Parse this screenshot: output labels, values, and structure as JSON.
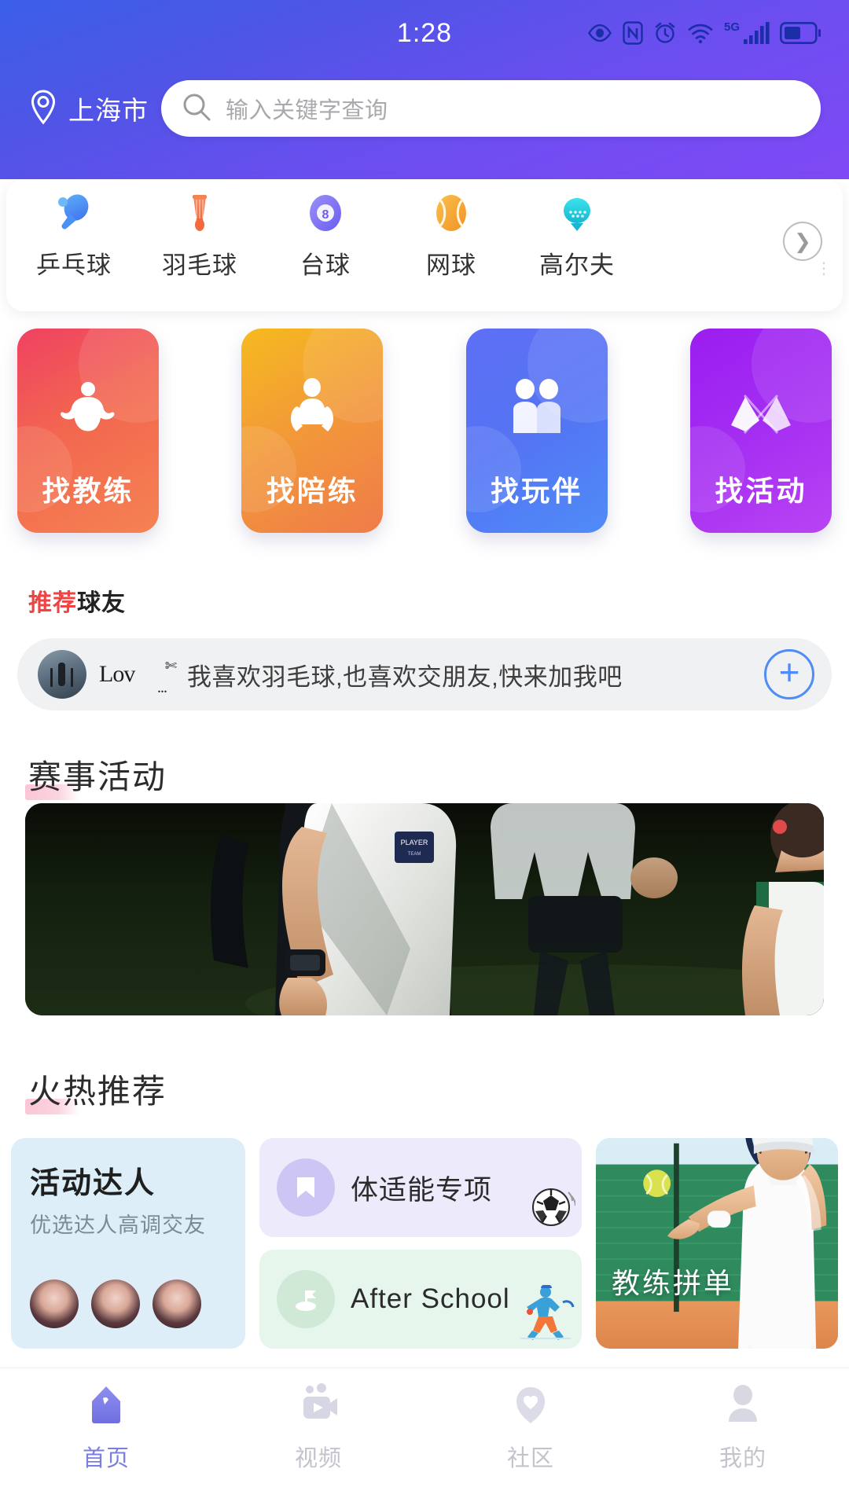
{
  "statusbar": {
    "time": "1:28",
    "network": "5G",
    "icons": [
      "eye-care-icon",
      "nfc-icon",
      "alarm-icon",
      "wifi-icon",
      "signal-icon",
      "battery-icon"
    ]
  },
  "header": {
    "location": "上海市",
    "location_icon": "location-pin-icon",
    "search_placeholder": "输入关键字查询",
    "search_icon": "search-icon",
    "gradient_from": "#3b5fe8",
    "gradient_to": "#8049f5"
  },
  "categories": {
    "more_icon": "chevron-right-icon",
    "items": [
      {
        "label": "乒乓球",
        "icon": "table-tennis-icon",
        "color": "#4a90f5"
      },
      {
        "label": "羽毛球",
        "icon": "badminton-icon",
        "color": "#f58352"
      },
      {
        "label": "台球",
        "icon": "billiards-icon",
        "color": "#7b6ef0"
      },
      {
        "label": "网球",
        "icon": "tennis-icon",
        "color": "#f5a623"
      },
      {
        "label": "高尔夫",
        "icon": "golf-icon",
        "color": "#2ed3e0"
      }
    ]
  },
  "actions": [
    {
      "label": "找教练",
      "icon": "muscle-coach-icon",
      "color": "#ef4162"
    },
    {
      "label": "找陪练",
      "icon": "training-partner-icon",
      "color": "#f6ba1f"
    },
    {
      "label": "找玩伴",
      "icon": "two-people-icon",
      "color": "#5e6ff5"
    },
    {
      "label": "找活动",
      "icon": "double-flag-icon",
      "color": "#9b1df0"
    }
  ],
  "friends_section": {
    "title_highlight": "推荐",
    "title_rest": "球友",
    "highlight_color": "#ef4444"
  },
  "friend": {
    "avatar": "user-avatar",
    "name": "Lov",
    "name_decoration": "✄",
    "name_dots": "...",
    "message": "我喜欢羽毛球,也喜欢交朋友,快来加我吧",
    "add_icon": "plus-circle-icon"
  },
  "events_section": {
    "title_highlight": "赛事",
    "title_rest": "活动",
    "banner_alt": "night-football-match-photo"
  },
  "hot_section": {
    "title_highlight": "火热",
    "title_rest": "推荐"
  },
  "hot_cards": {
    "featured": {
      "title": "活动达人",
      "subtitle": "优选达人高调交友",
      "avatar_count": 3,
      "bg": "#ddeef8"
    },
    "middle": [
      {
        "label": "体适能专项",
        "icon": "bookmark-icon",
        "art": "soccer-ball-icon",
        "bg": "#eceafb"
      },
      {
        "label": "After School",
        "icon": "golf-flag-icon",
        "art": "tennis-player-icon",
        "bg": "#e7f6ec"
      }
    ],
    "right": {
      "label": "教练拼单",
      "image_alt": "female-tennis-player-photo"
    }
  },
  "tabbar": {
    "items": [
      {
        "label": "首页",
        "icon": "home-icon",
        "active": true
      },
      {
        "label": "视频",
        "icon": "video-icon",
        "active": false
      },
      {
        "label": "社区",
        "icon": "community-heart-icon",
        "active": false
      },
      {
        "label": "我的",
        "icon": "profile-icon",
        "active": false
      }
    ],
    "active_color": "#7b7de0",
    "inactive_color": "#c3c3cd"
  }
}
